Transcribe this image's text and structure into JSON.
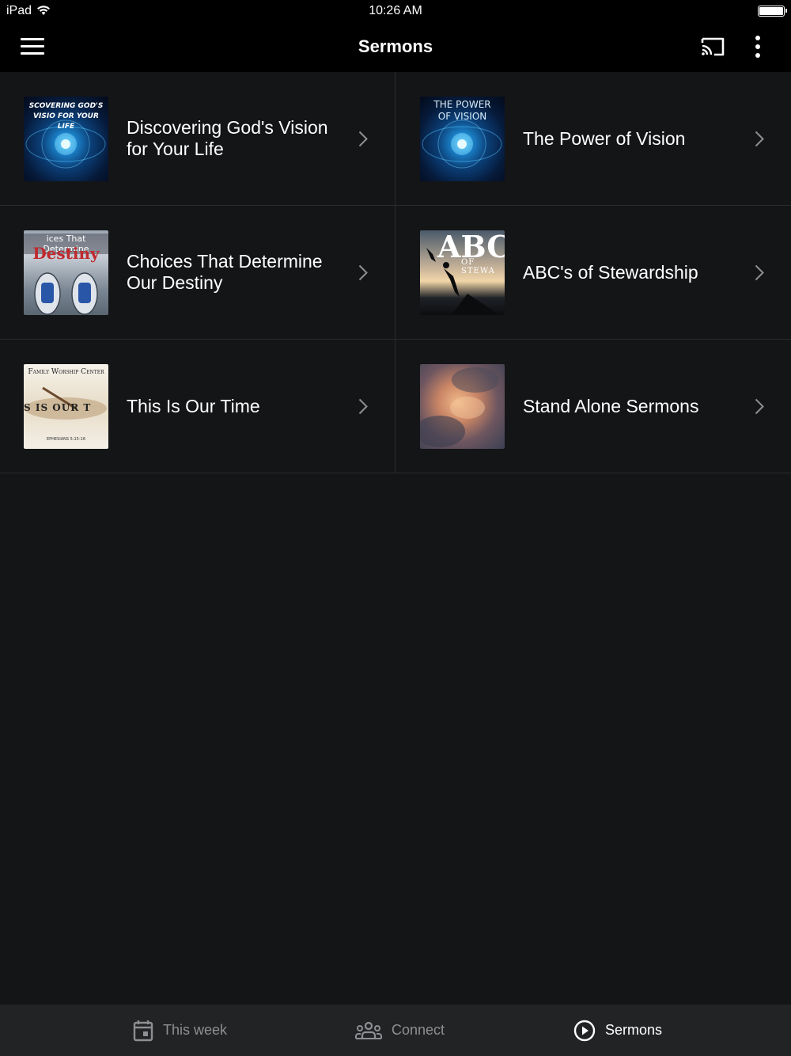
{
  "status_bar": {
    "device": "iPad",
    "time": "10:26 AM"
  },
  "nav": {
    "title": "Sermons"
  },
  "series": [
    {
      "title": "Discovering God's Vision for Your Life",
      "thumb_text": "SCOVERING GOD'S VISIO FOR YOUR LIFE"
    },
    {
      "title": "The Power of Vision",
      "thumb_text": "THE POWER OF VISION"
    },
    {
      "title": "Choices That Determine Our Destiny",
      "thumb_text": "ices That Determine",
      "thumb_text2": "Destiny"
    },
    {
      "title": "ABC's of Stewardship",
      "thumb_text": "ABC",
      "thumb_text2": "OF STEWA"
    },
    {
      "title": "This Is Our Time",
      "thumb_text": "Family Worship Center",
      "thumb_text2": "S IS OUR T",
      "thumb_text3": "EPHESIANS 5:15-16"
    },
    {
      "title": "Stand Alone Sermons"
    }
  ],
  "tabs": [
    {
      "label": "This week",
      "icon": "calendar-icon",
      "active": false
    },
    {
      "label": "Connect",
      "icon": "people-icon",
      "active": false
    },
    {
      "label": "Sermons",
      "icon": "play-circle-icon",
      "active": true
    }
  ]
}
